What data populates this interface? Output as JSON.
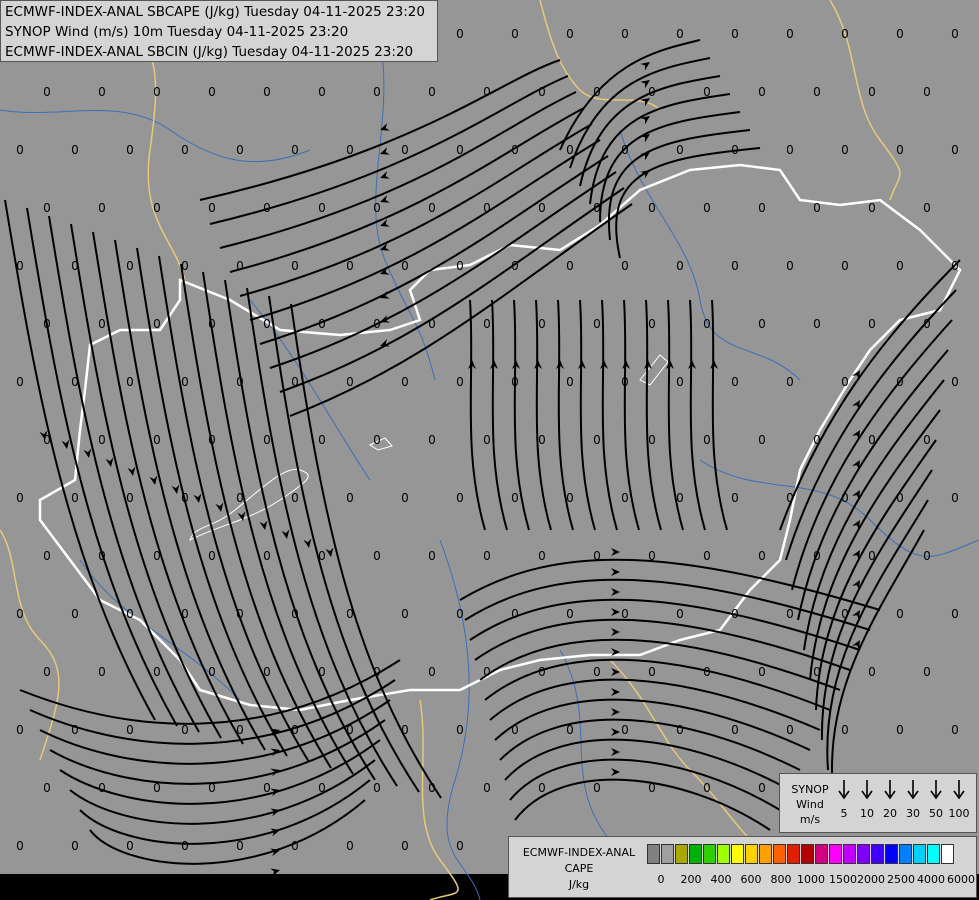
{
  "titles": [
    "ECMWF-INDEX-ANAL SBCAPE (J/kg) Tuesday 04-11-2025 23:20",
    "SYNOP Wind (m/s) 10m Tuesday 04-11-2025 23:20",
    "ECMWF-INDEX-ANAL SBCIN (J/kg) Tuesday 04-11-2025 23:20"
  ],
  "colors": {
    "background": "#969696",
    "streamline": "#000000",
    "border_national": "#ffffff",
    "border_foreign": "#e8c87a",
    "rivers": "#3c6fb4",
    "lakes": "#969696"
  },
  "grid_value": "0",
  "synop_legend": {
    "label_lines": [
      "SYNOP",
      "Wind",
      "m/s"
    ],
    "speeds": [
      "5",
      "10",
      "20",
      "30",
      "50",
      "100"
    ]
  },
  "cape_legend": {
    "label_lines": [
      "ECMWF-INDEX-ANAL",
      "CAPE",
      "J/kg"
    ],
    "colors": [
      "#808080",
      "#a0a0a0",
      "#a8a800",
      "#00b000",
      "#30d000",
      "#a0ff00",
      "#ffff00",
      "#ffd000",
      "#ffa000",
      "#ff6000",
      "#e02000",
      "#b00000",
      "#d00080",
      "#ff00ff",
      "#c000ff",
      "#8000ff",
      "#4000ff",
      "#0000ff",
      "#0080ff",
      "#00d0ff",
      "#00ffff",
      "#ffffff"
    ],
    "ticks": [
      "0",
      "200",
      "400",
      "600",
      "800",
      "1000",
      "1500",
      "2000",
      "2500",
      "4000",
      "6000"
    ]
  }
}
